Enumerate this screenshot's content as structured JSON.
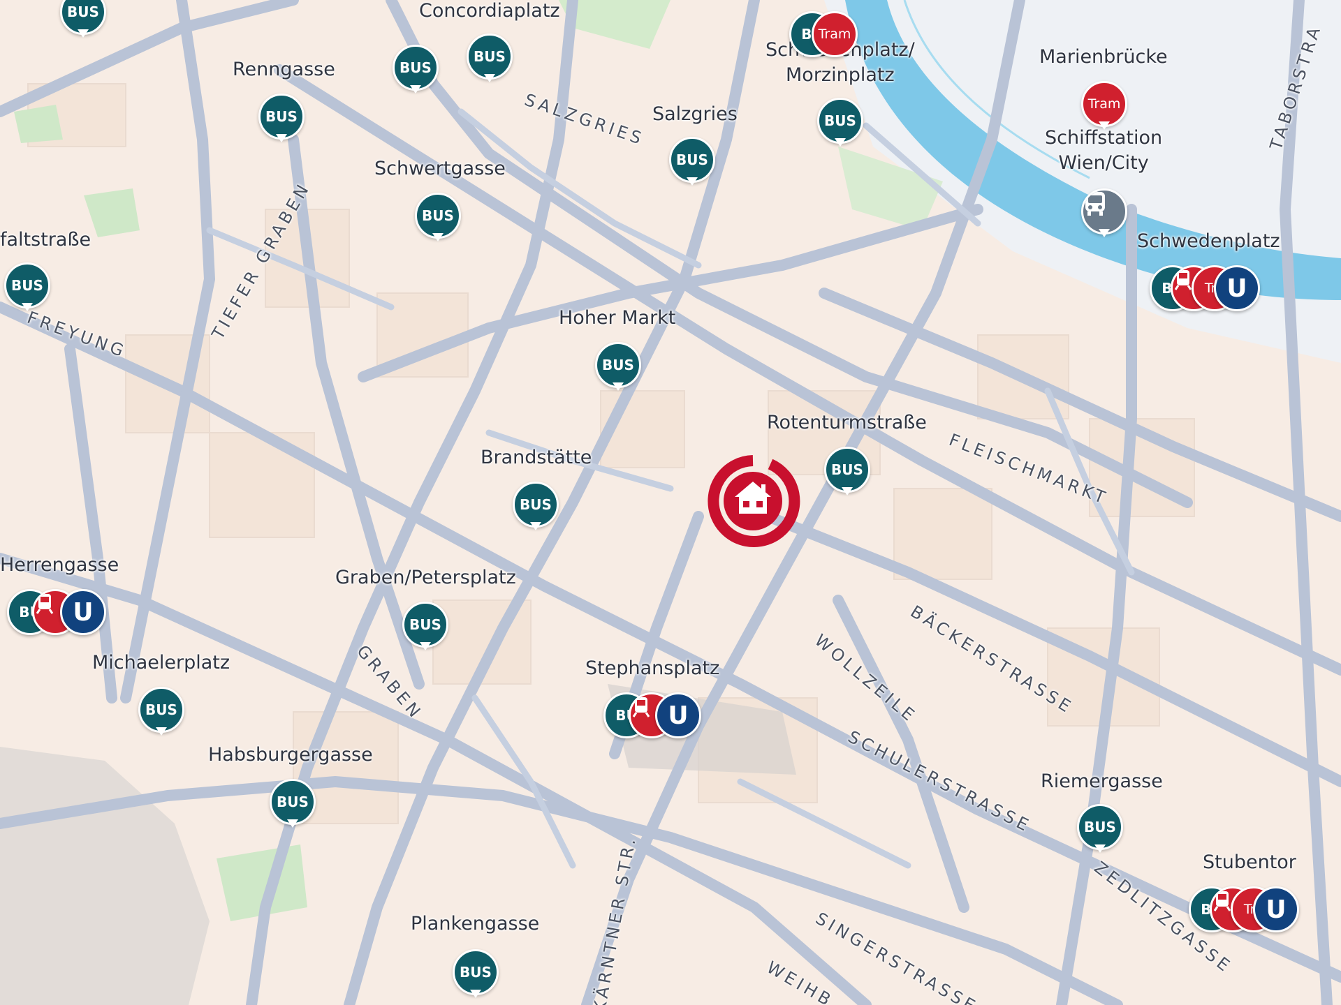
{
  "map": {
    "colors": {
      "background": "#f7ece4",
      "street": "#b9c3d6",
      "water": "#7ec8e8",
      "park": "#cfe8c8",
      "bus": "#0f5c67",
      "tram": "#d0202e",
      "ubahn": "#11427e",
      "home": "#c8102e"
    },
    "home_marker": {
      "icon": "house-icon",
      "label": ""
    },
    "stops": [
      {
        "id": "concordiaplatz",
        "label": "Concordiaplatz"
      },
      {
        "id": "renngasse",
        "label": "Renngasse"
      },
      {
        "id": "salzgries",
        "label": "Salzgries"
      },
      {
        "id": "schwertgasse",
        "label": "Schwertgasse"
      },
      {
        "id": "hoher-markt",
        "label": "Hoher Markt"
      },
      {
        "id": "brandstaette",
        "label": "Brandstätte"
      },
      {
        "id": "graben-petersplatz",
        "label": "Graben/Petersplatz"
      },
      {
        "id": "stephansplatz",
        "label": "Stephansplatz"
      },
      {
        "id": "rotenturmstrasse",
        "label": "Rotenturmstraße"
      },
      {
        "id": "schwedenplatz-morzinplatz",
        "label": "Schwedenplatz/\nMorzinplatz"
      },
      {
        "id": "marienbruecke",
        "label": "Marienbrücke"
      },
      {
        "id": "schiffstation",
        "label": "Schiffstation\nWien/City"
      },
      {
        "id": "schwedenplatz",
        "label": "Schwedenplatz"
      },
      {
        "id": "herrengasse",
        "label": "Herrengasse"
      },
      {
        "id": "michaelerplatz",
        "label": "Michaelerplatz"
      },
      {
        "id": "habsburgergasse",
        "label": "Habsburgergasse"
      },
      {
        "id": "plankengasse",
        "label": "Plankengasse"
      },
      {
        "id": "riemergasse",
        "label": "Riemergasse"
      },
      {
        "id": "stubentor",
        "label": "Stubentor"
      },
      {
        "id": "faltstrasse",
        "label": "faltstraße"
      }
    ],
    "pins": {
      "bus_text": "BUS",
      "bus_clipped": "BU",
      "tram_text": "Tram",
      "tram_clipped": "Tra",
      "ubahn_text": "U"
    },
    "streets": [
      {
        "id": "salzgries",
        "label": "SALZGRIES"
      },
      {
        "id": "tiefer-graben",
        "label": "TIEFER GRABEN"
      },
      {
        "id": "freyung",
        "label": "FREYUNG"
      },
      {
        "id": "fleischmarkt",
        "label": "FLEISCHMARKT"
      },
      {
        "id": "baeckerstrasse",
        "label": "BÄCKERSTRASSE"
      },
      {
        "id": "wollzeile",
        "label": "WOLLZEILE"
      },
      {
        "id": "schulerstrasse",
        "label": "SCHULERSTRASSE"
      },
      {
        "id": "zedlitzgasse",
        "label": "ZEDLITZGASSE"
      },
      {
        "id": "singerstrasse",
        "label": "SINGERSTRASSE"
      },
      {
        "id": "kaerntner",
        "label": "KÄRNTNER STR."
      },
      {
        "id": "graben",
        "label": "GRABEN"
      },
      {
        "id": "taborstrasse",
        "label": "TABORSTRA"
      },
      {
        "id": "weihburg",
        "label": "WEIHB"
      }
    ]
  }
}
